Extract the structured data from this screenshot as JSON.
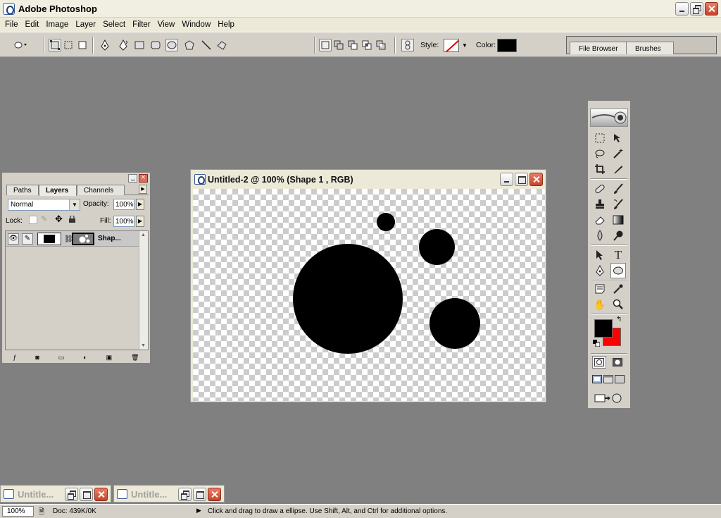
{
  "app": {
    "title": "Adobe Photoshop"
  },
  "menu": [
    "File",
    "Edit",
    "Image",
    "Layer",
    "Select",
    "Filter",
    "View",
    "Window",
    "Help"
  ],
  "options": {
    "style_label": "Style:",
    "color_label": "Color:",
    "color": "#000000"
  },
  "palette_well": {
    "tabs": [
      "File Browser",
      "Brushes"
    ]
  },
  "document": {
    "title": "Untitled-2 @ 100% (Shape 1 , RGB)",
    "shape_color": "#000000",
    "shapes": [
      {
        "name": "ellipse-small",
        "size": "small"
      },
      {
        "name": "ellipse-medium-top",
        "size": "medium"
      },
      {
        "name": "ellipse-large",
        "size": "large"
      },
      {
        "name": "ellipse-medium-bottom",
        "size": "medium"
      }
    ]
  },
  "layers_palette": {
    "tabs": [
      "Paths",
      "Layers",
      "Channels"
    ],
    "active_tab": "Layers",
    "blend_mode": "Normal",
    "opacity_label": "Opacity:",
    "opacity": "100%",
    "lock_label": "Lock:",
    "fill_label": "Fill:",
    "fill": "100%",
    "layer": {
      "name": "Shap..."
    }
  },
  "toolbox": {
    "foreground_color": "#000000",
    "background_color": "#ff0000",
    "tools": [
      "marquee",
      "move",
      "lasso",
      "magic-wand",
      "crop",
      "slice",
      "healing-brush",
      "brush",
      "clone-stamp",
      "history-brush",
      "eraser",
      "gradient",
      "blur",
      "dodge",
      "path-selection",
      "type",
      "pen",
      "ellipse",
      "notes",
      "eyedropper",
      "hand",
      "zoom"
    ]
  },
  "minimized_docs": [
    {
      "title": "Untitle..."
    },
    {
      "title": "Untitle..."
    }
  ],
  "status": {
    "zoom": "100%",
    "doc": "Doc: 439K/0K",
    "hint": "Click and drag to draw a ellipse.  Use Shift, Alt, and Ctrl for additional options."
  }
}
